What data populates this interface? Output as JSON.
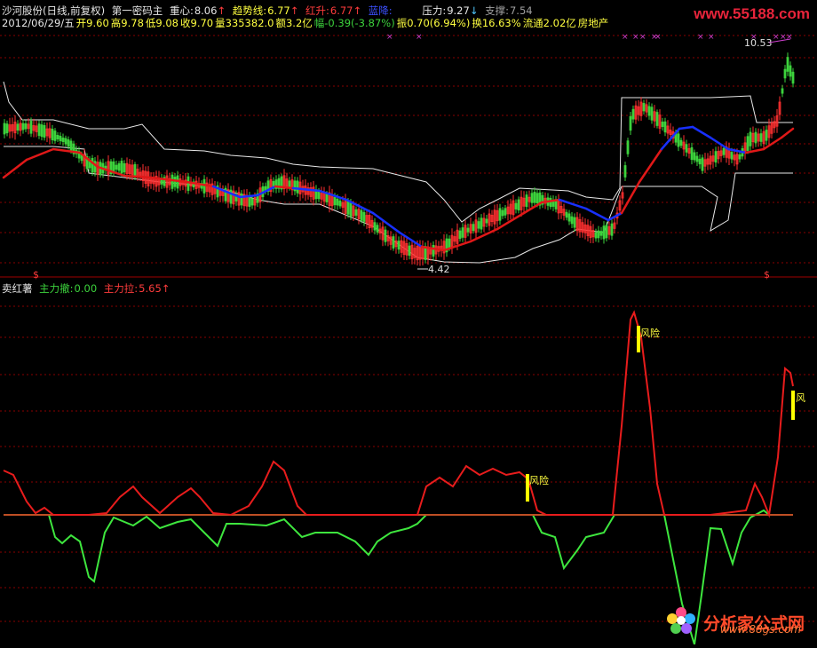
{
  "header_line1": {
    "stock": "沙河股份(日线,前复权)",
    "indicator": "第一密码主",
    "center_label": "重心:",
    "center_value": "8.06",
    "trend_label": "趋势线:",
    "trend_value": "6.77",
    "red_up_label": "红升:",
    "red_up_value": "6.77",
    "blue_down_label": "蓝降:",
    "pressure_label": "压力:",
    "pressure_value": "9.27",
    "support_label": "支撑:",
    "support_value": "7.54"
  },
  "header_line2": {
    "date": "2012/06/29/五",
    "open": "开9.60",
    "high": "高9.78",
    "low": "低9.08",
    "close": "收9.70",
    "volume": "量335382.0",
    "amount": "额3.2亿",
    "change": "幅-0.39(-3.87%)",
    "amplitude": "振0.70(6.94%)",
    "turnover": "换16.63%",
    "float": "流通2.02亿",
    "sector": "房地产"
  },
  "sub_header": {
    "title": "卖红薯",
    "main_withdraw_label": "主力撤:",
    "main_withdraw_value": "0.00",
    "main_pull_label": "主力拉:",
    "main_pull_value": "5.65"
  },
  "annotations": {
    "price_high": "10.53",
    "price_low": "4.42",
    "risk1": "风险",
    "risk2": "风险",
    "risk3": "风"
  },
  "markers": {
    "dollar_left": "$",
    "dollar_right": "$"
  },
  "watermarks": {
    "top": "www.55188.com",
    "bottom_main": "分析家公式网",
    "bottom_sub": "www.88gs.com"
  },
  "colors": {
    "background": "#000000",
    "up_candle": "#ff3030",
    "down_candle": "#3cd23c",
    "red_line": "#e01818",
    "blue_line": "#1830ff",
    "white_line": "#e8e8e8",
    "grid": "#8a0000",
    "indicator_red": "#e81c1c",
    "indicator_green": "#3ee63e",
    "risk_bar": "#ffff00",
    "header_white": "#e6e6e6",
    "header_yellow": "#ffff40",
    "header_red": "#ff3c3c",
    "header_blue": "#3c50ff",
    "header_green": "#3cd23c",
    "header_cyan": "#50c8ff"
  }
}
